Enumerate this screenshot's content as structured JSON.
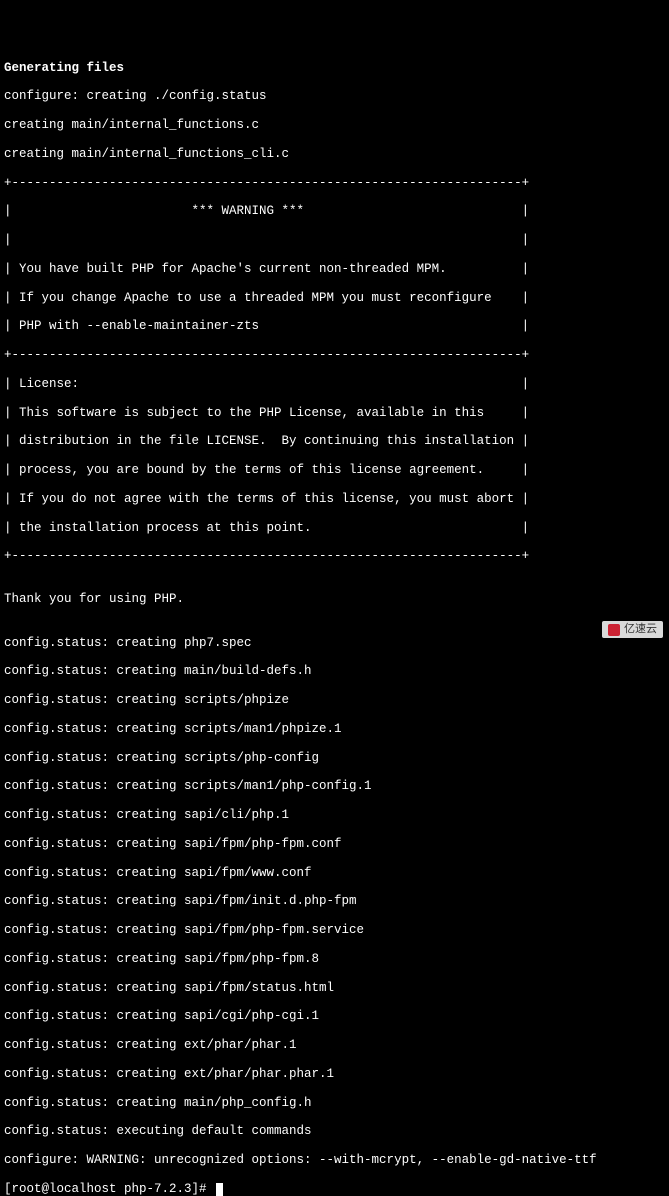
{
  "header": {
    "title": "Generating files"
  },
  "preamble": [
    "configure: creating ./config.status",
    "creating main/internal_functions.c",
    "creating main/internal_functions_cli.c"
  ],
  "warning_box": {
    "border_top": "+--------------------------------------------------------------------+",
    "warning_line": "|                        *** WARNING ***                             |",
    "blank_line": "|                                                                    |",
    "lines": [
      "| You have built PHP for Apache's current non-threaded MPM.          |",
      "| If you change Apache to use a threaded MPM you must reconfigure    |",
      "| PHP with --enable-maintainer-zts                                   |"
    ],
    "border_mid": "+--------------------------------------------------------------------+"
  },
  "license_box": {
    "lines": [
      "| License:                                                           |",
      "| This software is subject to the PHP License, available in this     |",
      "| distribution in the file LICENSE.  By continuing this installation |",
      "| process, you are bound by the terms of this license agreement.     |",
      "| If you do not agree with the terms of this license, you must abort |",
      "| the installation process at this point.                            |"
    ],
    "border_bot": "+--------------------------------------------------------------------+"
  },
  "thanks": "Thank you for using PHP.",
  "status_lines": [
    "config.status: creating php7.spec",
    "config.status: creating main/build-defs.h",
    "config.status: creating scripts/phpize",
    "config.status: creating scripts/man1/phpize.1",
    "config.status: creating scripts/php-config",
    "config.status: creating scripts/man1/php-config.1",
    "config.status: creating sapi/cli/php.1",
    "config.status: creating sapi/fpm/php-fpm.conf",
    "config.status: creating sapi/fpm/www.conf",
    "config.status: creating sapi/fpm/init.d.php-fpm",
    "config.status: creating sapi/fpm/php-fpm.service",
    "config.status: creating sapi/fpm/php-fpm.8",
    "config.status: creating sapi/fpm/status.html",
    "config.status: creating sapi/cgi/php-cgi.1",
    "config.status: creating ext/phar/phar.1",
    "config.status: creating ext/phar/phar.phar.1",
    "config.status: creating main/php_config.h",
    "config.status: executing default commands",
    "configure: WARNING: unrecognized options: --with-mcrypt, --enable-gd-native-ttf"
  ],
  "prompt": "[root@localhost php-7.2.3]# ",
  "watermark": "亿速云"
}
